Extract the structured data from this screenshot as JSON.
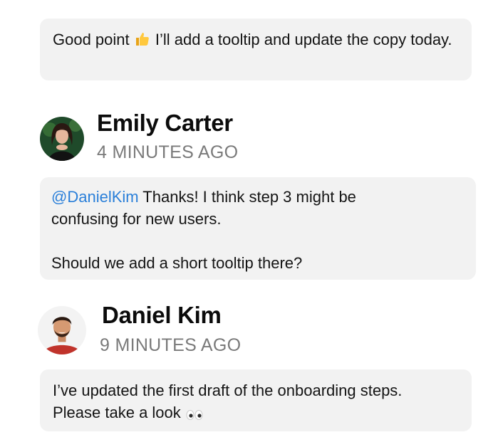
{
  "messages": [
    {
      "text_parts": [
        "Good point ",
        " I’ll add a tooltip and update the copy today."
      ],
      "emoji_icon": "thumbs-up-icon"
    },
    {
      "author": "Emily Carter",
      "timestamp": "4 MINUTES AGO",
      "mention": "@DanielKim",
      "line1": " Thanks! I think step 3 might be confusing for new users.",
      "line2": "Should we add a short tooltip there?"
    },
    {
      "author": "Daniel Kim",
      "timestamp": "9 MINUTES AGO",
      "text": "I’ve updated the first draft of the onboarding steps. Please take a look",
      "emoji_icon": "eyes-icon"
    }
  ],
  "colors": {
    "bubble": "#f2f2f2",
    "mention": "#2a7fd9",
    "timestamp": "#7a7a7a"
  }
}
